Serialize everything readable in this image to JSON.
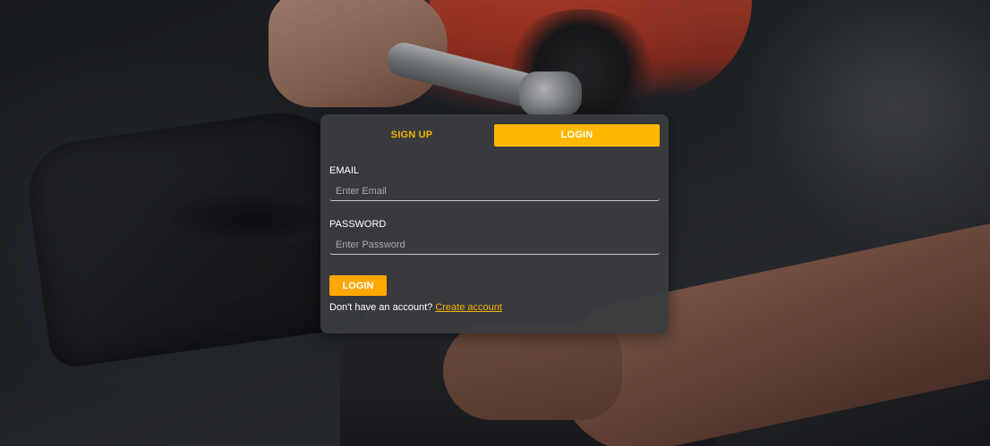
{
  "tabs": {
    "signup_label": "SIGN UP",
    "login_label": "LOGIN"
  },
  "form": {
    "email_label": "EMAIL",
    "email_placeholder": "Enter Email",
    "email_value": "",
    "password_label": "PASSWORD",
    "password_placeholder": "Enter Password",
    "password_value": "",
    "submit_label": "LOGIN",
    "account_prompt": "Don't have an account?",
    "create_account_label": "Create account"
  },
  "colors": {
    "accent": "#ffb800",
    "accent_text": "#f5b400",
    "panel_bg": "#3a3c40",
    "text": "#ffffff"
  }
}
